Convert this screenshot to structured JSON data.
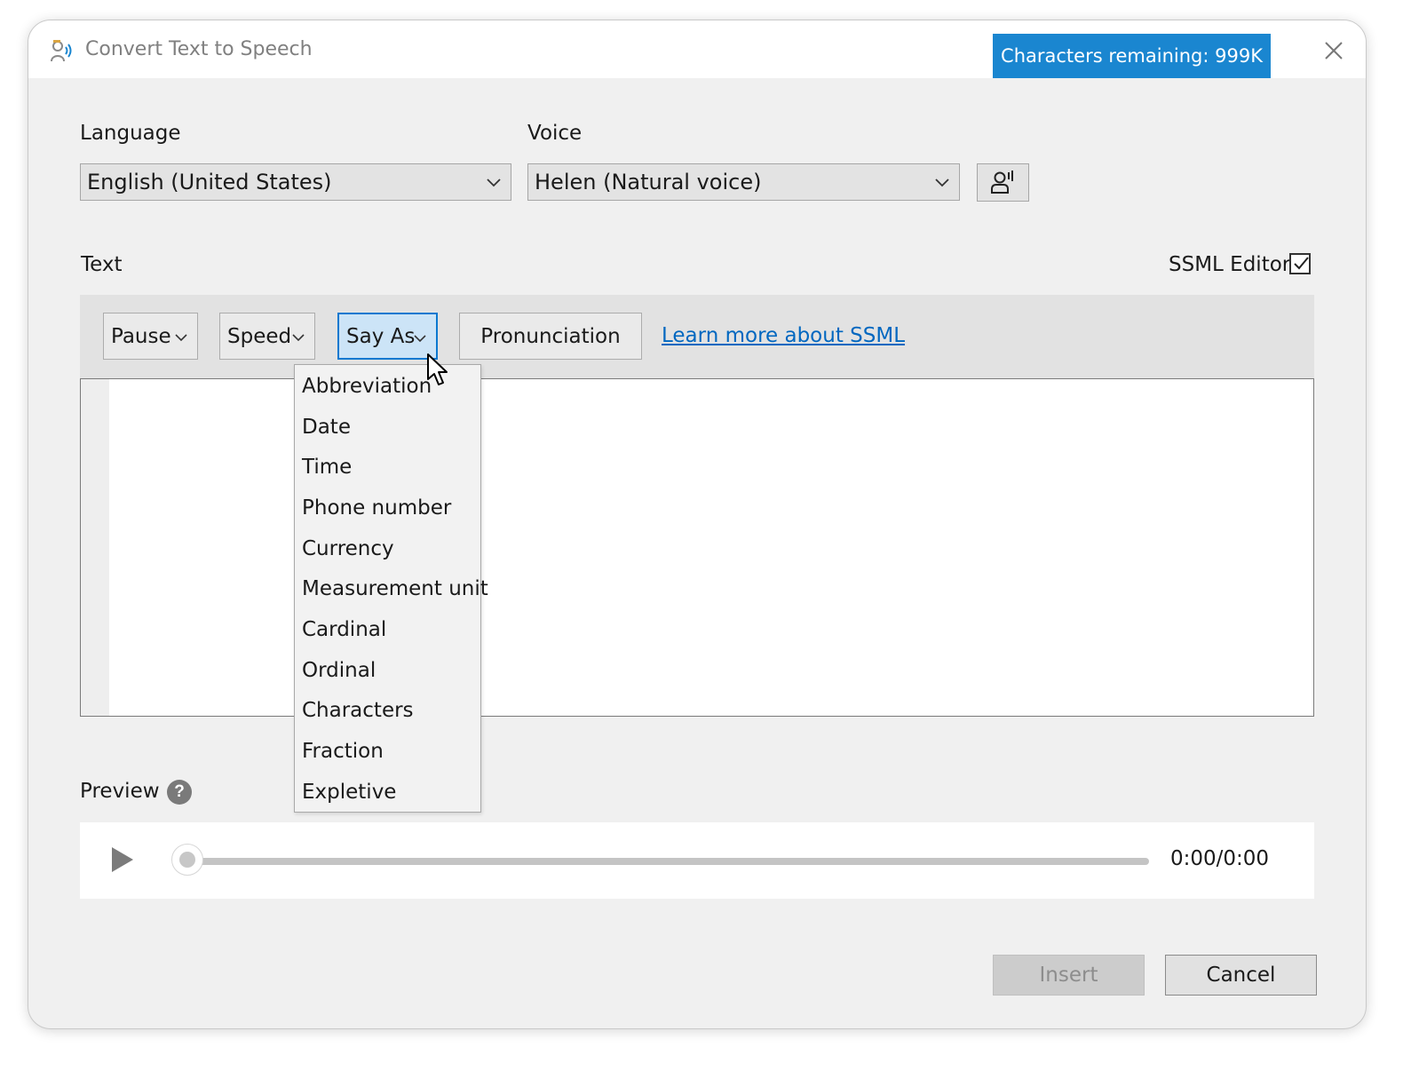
{
  "window": {
    "title": "Convert Text to Speech",
    "characters_remaining": "Characters remaining: 999K"
  },
  "language": {
    "label": "Language",
    "selected": "English (United States)"
  },
  "voice": {
    "label": "Voice",
    "selected": "Helen (Natural voice)"
  },
  "text_section": {
    "label": "Text",
    "ssml_editor_label": "SSML Editor",
    "ssml_editor_checked": true
  },
  "toolbar": {
    "pause_label": "Pause",
    "speed_label": "Speed",
    "say_as_label": "Say As",
    "pronunciation_label": "Pronunciation",
    "learn_more_link": "Learn more about SSML"
  },
  "say_as_menu": {
    "items": [
      "Abbreviation",
      "Date",
      "Time",
      "Phone number",
      "Currency",
      "Measurement unit",
      "Cardinal",
      "Ordinal",
      "Characters",
      "Fraction",
      "Expletive"
    ]
  },
  "editor": {
    "value": ""
  },
  "preview": {
    "label": "Preview",
    "help_glyph": "?",
    "time": "0:00/0:00",
    "progress": 0
  },
  "footer": {
    "insert_label": "Insert",
    "cancel_label": "Cancel"
  },
  "colors": {
    "accent": "#1a86d0",
    "link": "#0067c0",
    "selected_button": "#cce4f7"
  }
}
